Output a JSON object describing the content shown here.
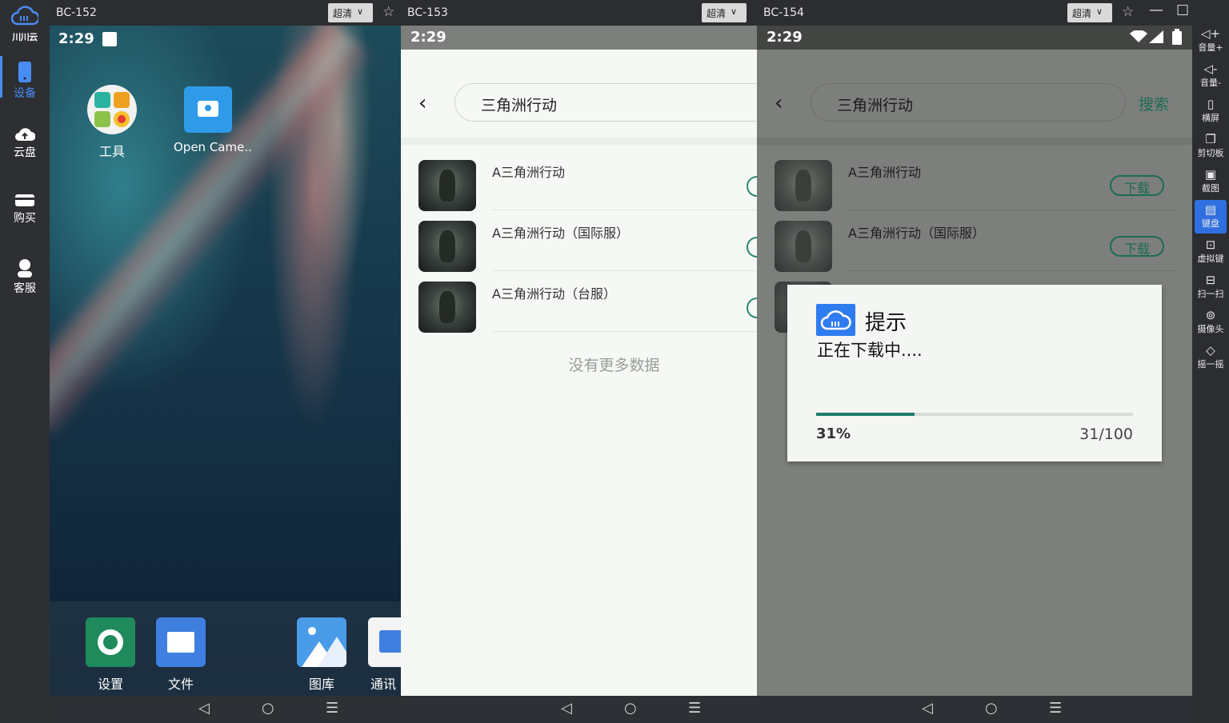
{
  "left_nav": {
    "logo_text": "川川云",
    "items": [
      {
        "label": "设备",
        "icon": "phone-icon"
      },
      {
        "label": "云盘",
        "icon": "cloud-upload-icon"
      },
      {
        "label": "购买",
        "icon": "card-icon"
      },
      {
        "label": "客服",
        "icon": "support-icon"
      }
    ]
  },
  "panels": [
    {
      "title": "BC-152",
      "quality": "超清"
    },
    {
      "title": "BC-153",
      "quality": "超清"
    },
    {
      "title": "BC-154",
      "quality": "超清"
    }
  ],
  "device1": {
    "time": "2:29",
    "desktop_apps": [
      {
        "label": "工具",
        "icon": "tools-folder-icon"
      },
      {
        "label": "Open Came..",
        "icon": "camera-icon"
      }
    ],
    "dock_apps": [
      {
        "label": "设置",
        "icon": "settings-icon"
      },
      {
        "label": "文件",
        "icon": "folder-icon"
      },
      {
        "label": "图库",
        "icon": "gallery-icon"
      },
      {
        "label": "通讯",
        "icon": "contacts-icon"
      }
    ]
  },
  "device2": {
    "time": "2:29",
    "search_value": "三角洲行动",
    "results": [
      {
        "title": "A三角洲行动"
      },
      {
        "title": "A三角洲行动（国际服）"
      },
      {
        "title": "A三角洲行动（台服）"
      }
    ],
    "no_more": "没有更多数据"
  },
  "device3": {
    "time": "2:29",
    "search_value": "三角洲行动",
    "search_button": "搜索",
    "results": [
      {
        "title": "A三角洲行动",
        "action": "下载"
      },
      {
        "title": "A三角洲行动（国际服）",
        "action": "下载"
      }
    ],
    "dialog": {
      "title": "提示",
      "message": "正在下载中....",
      "progress": 0.31,
      "percent_text": "31%",
      "count_text": "31/100"
    }
  },
  "right_tools": [
    {
      "label": "音量+",
      "icon": "volume-up-icon"
    },
    {
      "label": "音量-",
      "icon": "volume-down-icon"
    },
    {
      "label": "横屏",
      "icon": "rotate-icon"
    },
    {
      "label": "剪切板",
      "icon": "clipboard-icon"
    },
    {
      "label": "截图",
      "icon": "screenshot-icon"
    },
    {
      "label": "键盘",
      "icon": "keyboard-icon"
    },
    {
      "label": "虚拟键",
      "icon": "virtual-keys-icon"
    },
    {
      "label": "扫一扫",
      "icon": "scan-icon"
    },
    {
      "label": "摄像头",
      "icon": "camera-icon"
    },
    {
      "label": "摇一摇",
      "icon": "shake-icon"
    }
  ],
  "colors": {
    "accent_blue": "#2f6fe0",
    "download_green": "#2b8a6e",
    "progress_green": "#1e7d6a"
  }
}
